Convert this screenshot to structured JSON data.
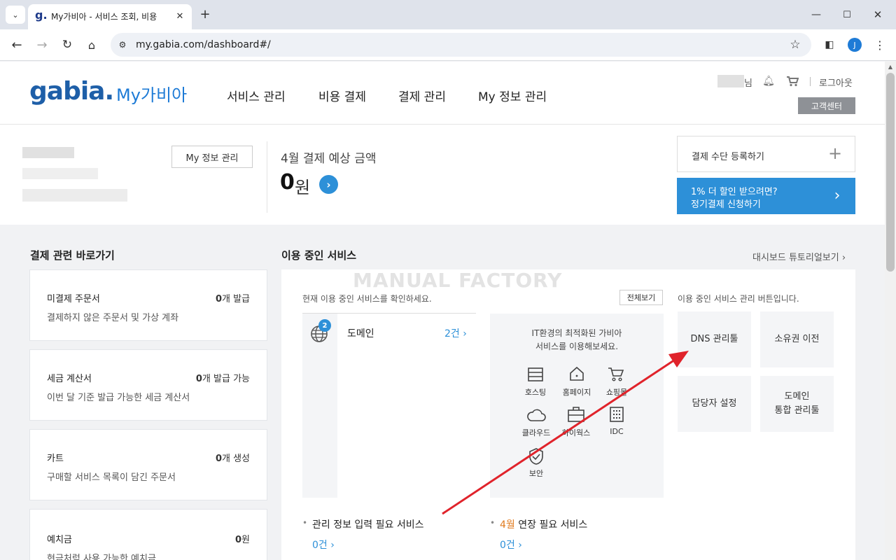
{
  "browser": {
    "tab_title": "My가비아 - 서비스 조회, 비용",
    "url": "my.gabia.com/dashboard#/",
    "profile_initial": "J"
  },
  "header": {
    "logo": "gabia.",
    "logo_sub": "My가비아",
    "nav": [
      "서비스 관리",
      "비용 결제",
      "결제 관리",
      "My 정보 관리"
    ],
    "user_suffix": "님",
    "logout": "로그아웃",
    "support": "고객센터"
  },
  "summary": {
    "my_info_button": "My 정보 관리",
    "payment_title": "4월 결제 예상 금액",
    "amount": "0",
    "currency": "원",
    "register_method": "결제 수단 등록하기",
    "discount_line1": "1% 더 할인 받으려면?",
    "discount_line2": "정기결제 신청하기"
  },
  "shortcuts": {
    "title": "결제 관련 바로가기",
    "cards": [
      {
        "title": "미결제 주문서",
        "count": "0",
        "unit": "개 발급",
        "desc": "결제하지 않은 주문서 및 가상 계좌"
      },
      {
        "title": "세금 계산서",
        "count": "0",
        "unit": "개 발급 가능",
        "desc": "이번 달 기준 발급 가능한 세금 계산서"
      },
      {
        "title": "카트",
        "count": "0",
        "unit": "개 생성",
        "desc": "구매할 서비스 목록이 담긴 주문서"
      },
      {
        "title": "예치금",
        "count": "0",
        "unit": "원",
        "desc": "현금처럼 사용 가능한 예치금"
      }
    ]
  },
  "services": {
    "title": "이용 중인 서비스",
    "tutorial_link": "대시보드 튜토리얼보기",
    "watermark": "MANUAL FACTORY",
    "intro": "현재 이용 중인 서비스를 확인하세요.",
    "view_all": "전체보기",
    "domain_label": "도메인",
    "domain_badge": "2",
    "domain_count": "2건",
    "promo_line1": "IT환경의 최적화된 가비아",
    "promo_line2": "서비스를 이용해보세요.",
    "promo_items": [
      "호스팅",
      "홈페이지",
      "쇼핑몰",
      "클라우드",
      "하이웍스",
      "IDC",
      "보안"
    ],
    "manage_intro": "이용 중인 서비스 관리 버튼입니다.",
    "manage_buttons": [
      "DNS 관리툴",
      "소유권 이전",
      "담당자 설정",
      "도메인\n통합 관리툴"
    ],
    "need_info_label": "관리 정보 입력 필요 서비스",
    "need_info_count": "0건",
    "renew_month": "4월",
    "renew_label": " 연장 필요 서비스",
    "renew_count": "0건"
  },
  "colors": {
    "brand_blue": "#1e7bd6",
    "accent": "#2d90d8",
    "orange": "#e07b1f",
    "arrow": "#e0232b"
  }
}
